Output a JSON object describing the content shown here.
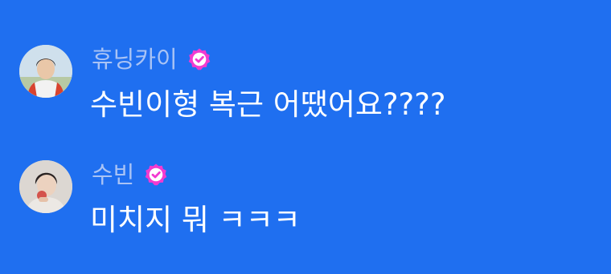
{
  "colors": {
    "background": "#1f6ff0",
    "username": "#a9c3f5",
    "message_text": "#ffffff",
    "verified_badge": "#f23ad0"
  },
  "messages": [
    {
      "username": "휴닝카이",
      "verified": true,
      "avatar_icon": "user-avatar-photo",
      "text": "수빈이형 복근 어땠어요????"
    },
    {
      "username": "수빈",
      "verified": true,
      "avatar_icon": "user-avatar-photo",
      "text": "미치지 뭐 ㅋㅋㅋ"
    }
  ]
}
